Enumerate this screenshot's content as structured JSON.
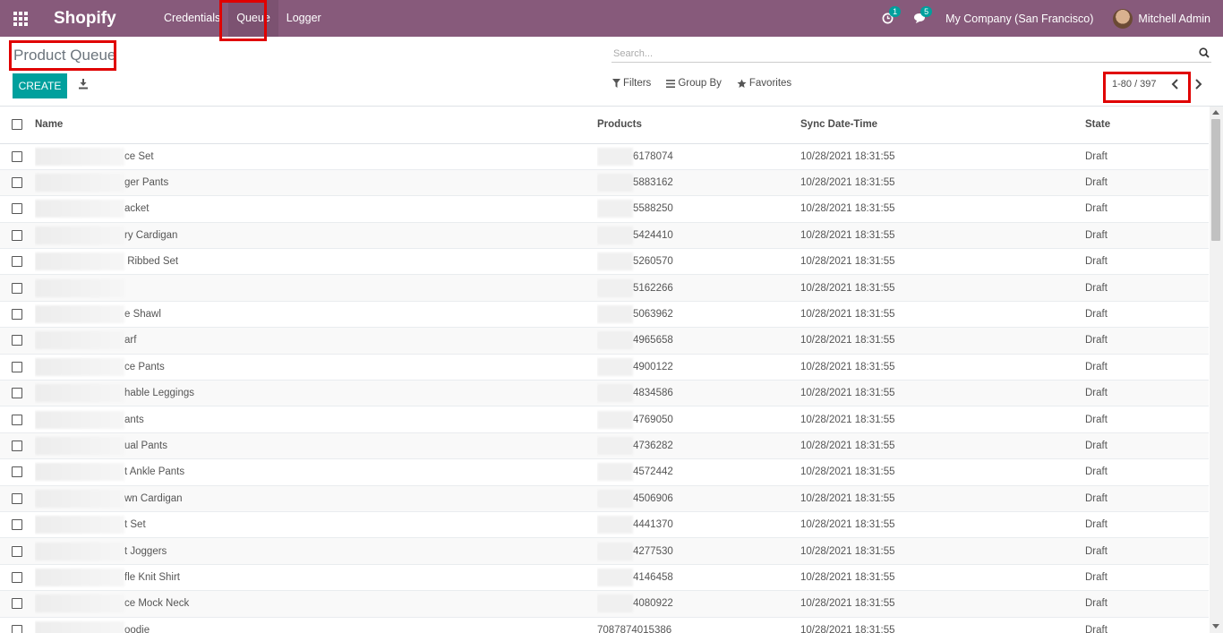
{
  "navbar": {
    "brand": "Shopify",
    "menu": [
      {
        "label": "Credentials"
      },
      {
        "label": "Queue"
      },
      {
        "label": "Logger"
      }
    ],
    "activity_badge": "1",
    "messages_badge": "5",
    "company": "My Company (San Francisco)",
    "user": "Mitchell Admin"
  },
  "control_panel": {
    "breadcrumb": "Product Queue",
    "create_label": "CREATE",
    "search_placeholder": "Search...",
    "filters_label": "Filters",
    "groupby_label": "Group By",
    "favorites_label": "Favorites",
    "pager": "1-80 / 397"
  },
  "table": {
    "columns": [
      "Name",
      "Products",
      "Sync Date-Time",
      "State"
    ],
    "rows": [
      {
        "name": "ce Set",
        "products": "6178074",
        "date": "10/28/2021 18:31:55",
        "state": "Draft"
      },
      {
        "name": "ger Pants",
        "products": "5883162",
        "date": "10/28/2021 18:31:55",
        "state": "Draft"
      },
      {
        "name": "acket",
        "products": "5588250",
        "date": "10/28/2021 18:31:55",
        "state": "Draft"
      },
      {
        "name": "ry Cardigan",
        "products": "5424410",
        "date": "10/28/2021 18:31:55",
        "state": "Draft"
      },
      {
        "name": " Ribbed Set",
        "products": "5260570",
        "date": "10/28/2021 18:31:55",
        "state": "Draft"
      },
      {
        "name": "",
        "products": "5162266",
        "date": "10/28/2021 18:31:55",
        "state": "Draft"
      },
      {
        "name": "e Shawl",
        "products": "5063962",
        "date": "10/28/2021 18:31:55",
        "state": "Draft"
      },
      {
        "name": "arf",
        "products": "4965658",
        "date": "10/28/2021 18:31:55",
        "state": "Draft"
      },
      {
        "name": "ce Pants",
        "products": "4900122",
        "date": "10/28/2021 18:31:55",
        "state": "Draft"
      },
      {
        "name": "hable Leggings",
        "products": "4834586",
        "date": "10/28/2021 18:31:55",
        "state": "Draft"
      },
      {
        "name": "ants",
        "products": "4769050",
        "date": "10/28/2021 18:31:55",
        "state": "Draft"
      },
      {
        "name": "ual Pants",
        "products": "4736282",
        "date": "10/28/2021 18:31:55",
        "state": "Draft"
      },
      {
        "name": "t Ankle Pants",
        "products": "4572442",
        "date": "10/28/2021 18:31:55",
        "state": "Draft"
      },
      {
        "name": "wn Cardigan",
        "products": "4506906",
        "date": "10/28/2021 18:31:55",
        "state": "Draft"
      },
      {
        "name": "t Set",
        "products": "4441370",
        "date": "10/28/2021 18:31:55",
        "state": "Draft"
      },
      {
        "name": "t Joggers",
        "products": "4277530",
        "date": "10/28/2021 18:31:55",
        "state": "Draft"
      },
      {
        "name": "fle Knit Shirt",
        "products": "4146458",
        "date": "10/28/2021 18:31:55",
        "state": "Draft"
      },
      {
        "name": "ce Mock Neck",
        "products": "4080922",
        "date": "10/28/2021 18:31:55",
        "state": "Draft"
      },
      {
        "name": "oodie",
        "products": "7087874015386",
        "date": "10/28/2021 18:31:55",
        "state": "Draft"
      }
    ]
  }
}
